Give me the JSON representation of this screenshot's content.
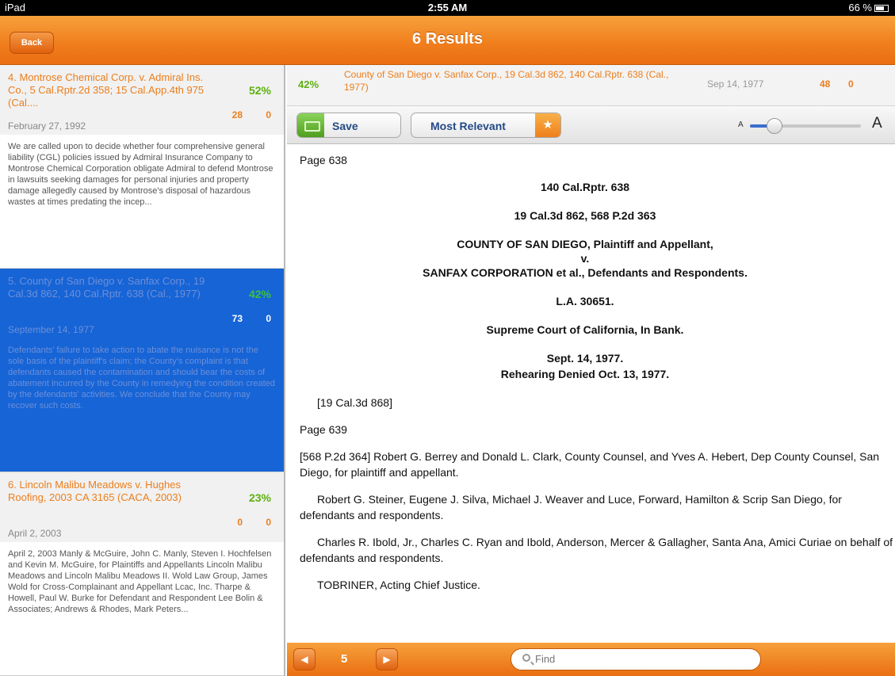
{
  "status": {
    "device": "iPad",
    "time": "2:55 AM",
    "battery": "66 %"
  },
  "nav": {
    "back_label": "Back",
    "title": "6 Results"
  },
  "results": [
    {
      "title": "4. Montrose Chemical Corp. v. Admiral Ins. Co., 5 Cal.Rptr.2d 358; 15 Cal.App.4th 975 (Cal....",
      "date": "February 27, 1992",
      "percent": "52%",
      "count_a": "28",
      "count_b": "0",
      "snippet": "We are called upon to decide whether four comprehensive general liability (CGL) policies issued by Admiral Insurance Company to Montrose Chemical Corporation obligate Admiral to defend Montrose in lawsuits seeking damages for personal injuries and property damage allegedly caused by Montrose's disposal of hazardous wastes at times predating the incep..."
    },
    {
      "title": "5. County of San Diego v. Sanfax Corp., 19 Cal.3d 862, 140 Cal.Rptr. 638 (Cal., 1977)",
      "date": "September 14, 1977",
      "percent": "42%",
      "count_a": "73",
      "count_b": "0",
      "snippet": "Defendants' failure to take action to abate the nuisance is not the sole basis of the plaintiff's claim; the County's complaint is that defendants caused the contamination and should bear the costs of abatement incurred by the County in remedying the condition created by the defendants' activities. We conclude that the County may recover such costs."
    },
    {
      "title": "6. Lincoln Malibu Meadows v. Hughes Roofing, 2003 CA 3165 (CACA, 2003)",
      "date": "April 2, 2003",
      "percent": "23%",
      "count_a": "0",
      "count_b": "0",
      "snippet": "April 2, 2003 Manly & McGuire, John C. Manly, Steven I. Hochfelsen and Kevin M. McGuire, for Plaintiffs and Appellants Lincoln Malibu Meadows and Lincoln Malibu Meadows II. Wold Law Group, James Wold for Cross-Complainant and Appellant Lcac, Inc. Tharpe & Howell, Paul W. Burke for Defendant and Respondent Lee Bolin & Associates; Andrews & Rhodes, Mark Peters..."
    }
  ],
  "current": {
    "percent": "42%",
    "title": "County of San Diego v. Sanfax Corp., 19 Cal.3d 862, 140 Cal.Rptr. 638 (Cal., 1977)",
    "date": "Sep 14, 1977",
    "count_a": "48",
    "count_b": "0"
  },
  "toolbar": {
    "save_label": "Save",
    "sort_label": "Most Relevant",
    "font_small": "A",
    "font_large": "A",
    "font_size_level": 0.22
  },
  "document": {
    "page_a": "Page 638",
    "cite1": "140 Cal.Rptr. 638",
    "cite2": "19 Cal.3d 862, 568 P.2d 363",
    "party1": "COUNTY OF SAN DIEGO, Plaintiff and Appellant,",
    "v": "v.",
    "party2": "SANFAX CORPORATION et al., Defendants and Respondents.",
    "docket": "L.A. 30651.",
    "court": "Supreme Court of California, In Bank.",
    "date1": "Sept. 14, 1977.",
    "date2": "Rehearing Denied Oct. 13, 1977.",
    "ref": "[19 Cal.3d 868]",
    "page_b": "Page 639",
    "counsel1": "[568 P.2d 364] Robert G. Berrey and Donald L. Clark, County Counsel, and Yves A. Hebert, Dep County Counsel, San Diego, for plaintiff and appellant.",
    "counsel2": "Robert G. Steiner, Eugene J. Silva, Michael J. Weaver and Luce, Forward, Hamilton & Scrip San Diego, for defendants and respondents.",
    "counsel3": "Charles R. Ibold, Jr., Charles C. Ryan and Ibold, Anderson, Mercer & Gallagher, Santa Ana, Amici Curiae on behalf of defendants and respondents.",
    "judge": "TOBRINER, Acting Chief Justice."
  },
  "bottom": {
    "page_number": "5",
    "find_placeholder": "Find"
  }
}
